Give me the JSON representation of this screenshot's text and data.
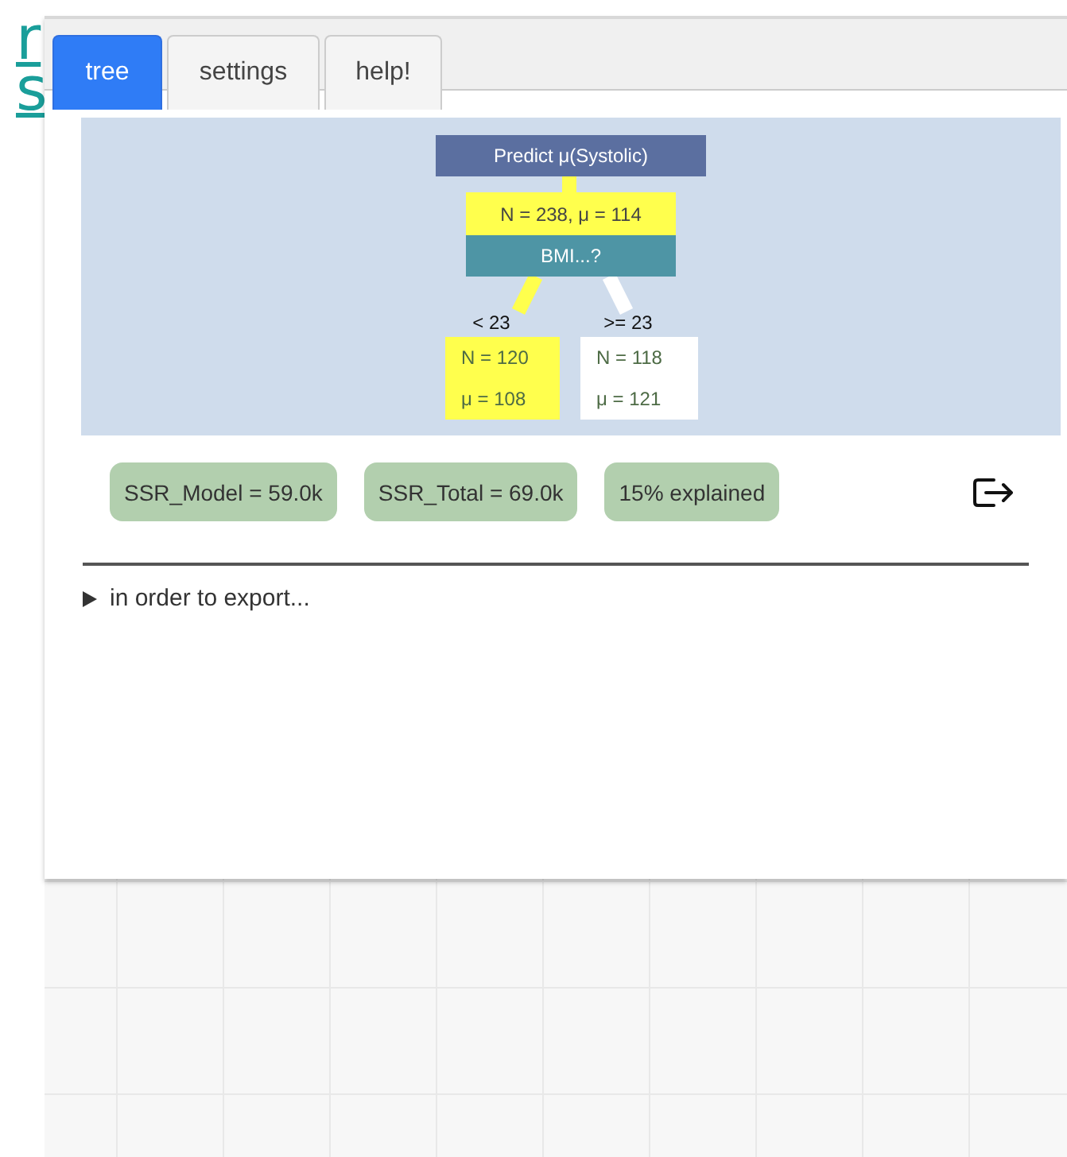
{
  "background_links": [
    {
      "text": "r"
    },
    {
      "text": "s"
    }
  ],
  "tabs": [
    {
      "label": "tree",
      "selected": true
    },
    {
      "label": "settings",
      "selected": false
    },
    {
      "label": "help!",
      "selected": false
    }
  ],
  "tree": {
    "title": "Predict μ(Systolic)",
    "root": {
      "stats": "N = 238, μ = 114",
      "split": "BMI...?",
      "highlighted": true
    },
    "branches": [
      {
        "condition": "< 23",
        "count": "N = 120",
        "mean": "μ = 108",
        "highlighted": true
      },
      {
        "condition": ">= 23",
        "count": "N = 118",
        "mean": "μ = 121",
        "highlighted": false
      }
    ]
  },
  "stats": [
    "SSR_Model = 59.0k",
    "SSR_Total = 69.0k",
    "15% explained"
  ],
  "export_note": {
    "text": "in order to export...",
    "expanded": false
  }
}
